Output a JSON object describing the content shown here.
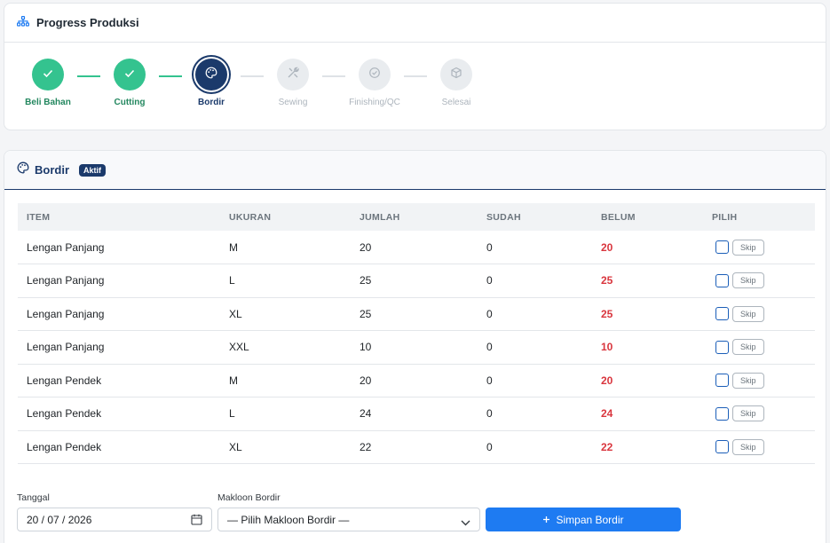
{
  "progress": {
    "title": "Progress Produksi",
    "steps": [
      {
        "label": "Beli Bahan",
        "status": "done",
        "icon": "check-icon"
      },
      {
        "label": "Cutting",
        "status": "done",
        "icon": "check-icon"
      },
      {
        "label": "Bordir",
        "status": "active",
        "icon": "palette-icon"
      },
      {
        "label": "Sewing",
        "status": "todo",
        "icon": "tools-icon"
      },
      {
        "label": "Finishing/QC",
        "status": "todo",
        "icon": "check-circle-icon"
      },
      {
        "label": "Selesai",
        "status": "todo",
        "icon": "box-icon"
      }
    ]
  },
  "bordir": {
    "title": "Bordir",
    "badge": "Aktif",
    "columns": [
      "ITEM",
      "UKURAN",
      "JUMLAH",
      "SUDAH",
      "BELUM",
      "PILIH"
    ],
    "rows": [
      {
        "item": "Lengan Panjang",
        "ukuran": "M",
        "jumlah": "20",
        "sudah": "0",
        "belum": "20"
      },
      {
        "item": "Lengan Panjang",
        "ukuran": "L",
        "jumlah": "25",
        "sudah": "0",
        "belum": "25"
      },
      {
        "item": "Lengan Panjang",
        "ukuran": "XL",
        "jumlah": "25",
        "sudah": "0",
        "belum": "25"
      },
      {
        "item": "Lengan Panjang",
        "ukuran": "XXL",
        "jumlah": "10",
        "sudah": "0",
        "belum": "10"
      },
      {
        "item": "Lengan Pendek",
        "ukuran": "M",
        "jumlah": "20",
        "sudah": "0",
        "belum": "20"
      },
      {
        "item": "Lengan Pendek",
        "ukuran": "L",
        "jumlah": "24",
        "sudah": "0",
        "belum": "24"
      },
      {
        "item": "Lengan Pendek",
        "ukuran": "XL",
        "jumlah": "22",
        "sudah": "0",
        "belum": "22"
      }
    ],
    "skip_label": "Skip",
    "form": {
      "tanggal_label": "Tanggal",
      "tanggal_value": "20 / 07 / 2026",
      "makloon_label": "Makloon Bordir",
      "makloon_value": "— Pilih Makloon Bordir —",
      "submit_label": "Simpan Bordir"
    }
  },
  "colors": {
    "primary": "#1e7bf2",
    "navy": "#1b3a6b",
    "done": "#34c38f",
    "danger": "#d9363e"
  }
}
